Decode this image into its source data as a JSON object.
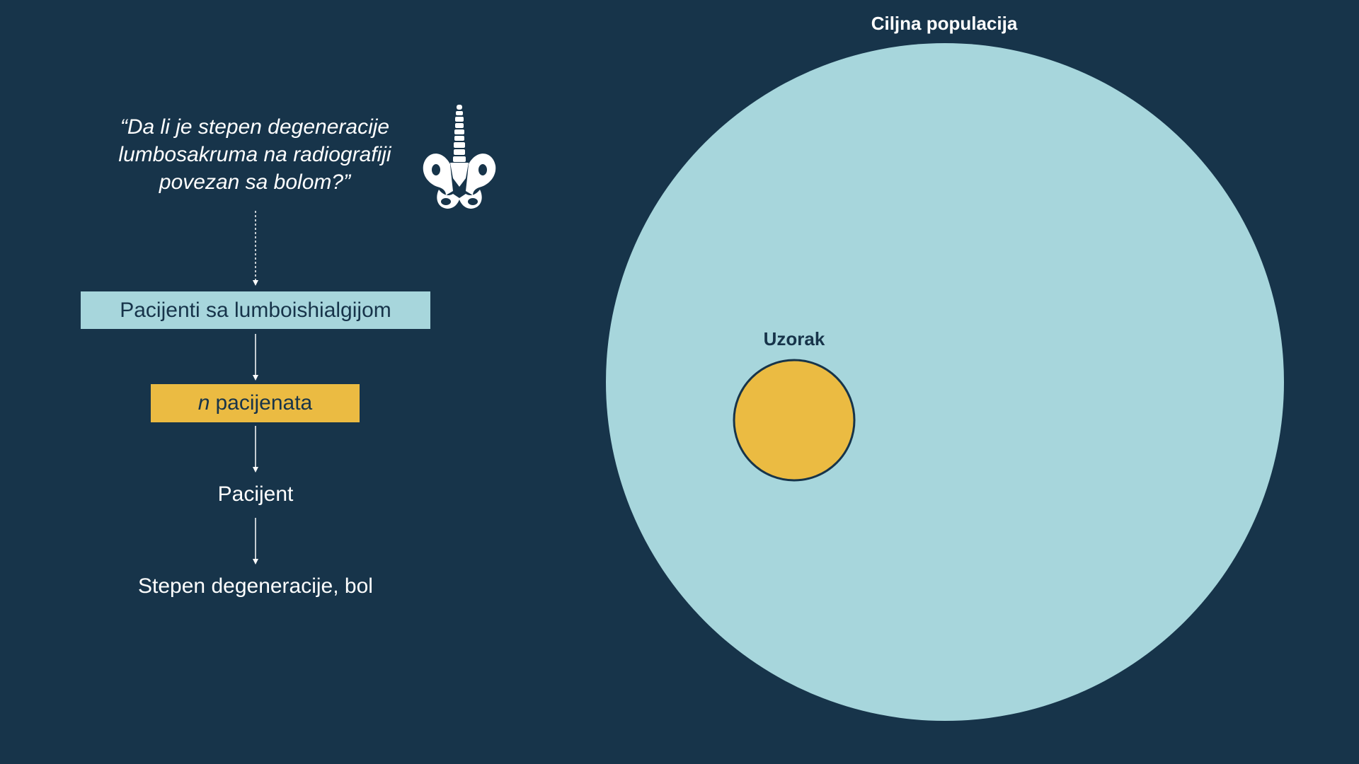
{
  "diagram": {
    "question": "“Da li je stepen degeneracije lumbosakruma na radiografiji povezan sa bolom?”",
    "pelvis_icon": "pelvis-spine-icon",
    "population_box": "Pacijenti sa lumboishialgijom",
    "sample_box": {
      "variable": "n",
      "text": "pacijenata"
    },
    "unit_label": "Pacijent",
    "variables_label": "Stepen degeneracije, bol",
    "target_population_label": "Ciljna populacija",
    "sample_label": "Uzorak"
  },
  "colors": {
    "background": "#17344a",
    "population": "#a7d6dc",
    "sample": "#ebbb42",
    "text_light": "#ffffff",
    "text_dark": "#17344a"
  }
}
